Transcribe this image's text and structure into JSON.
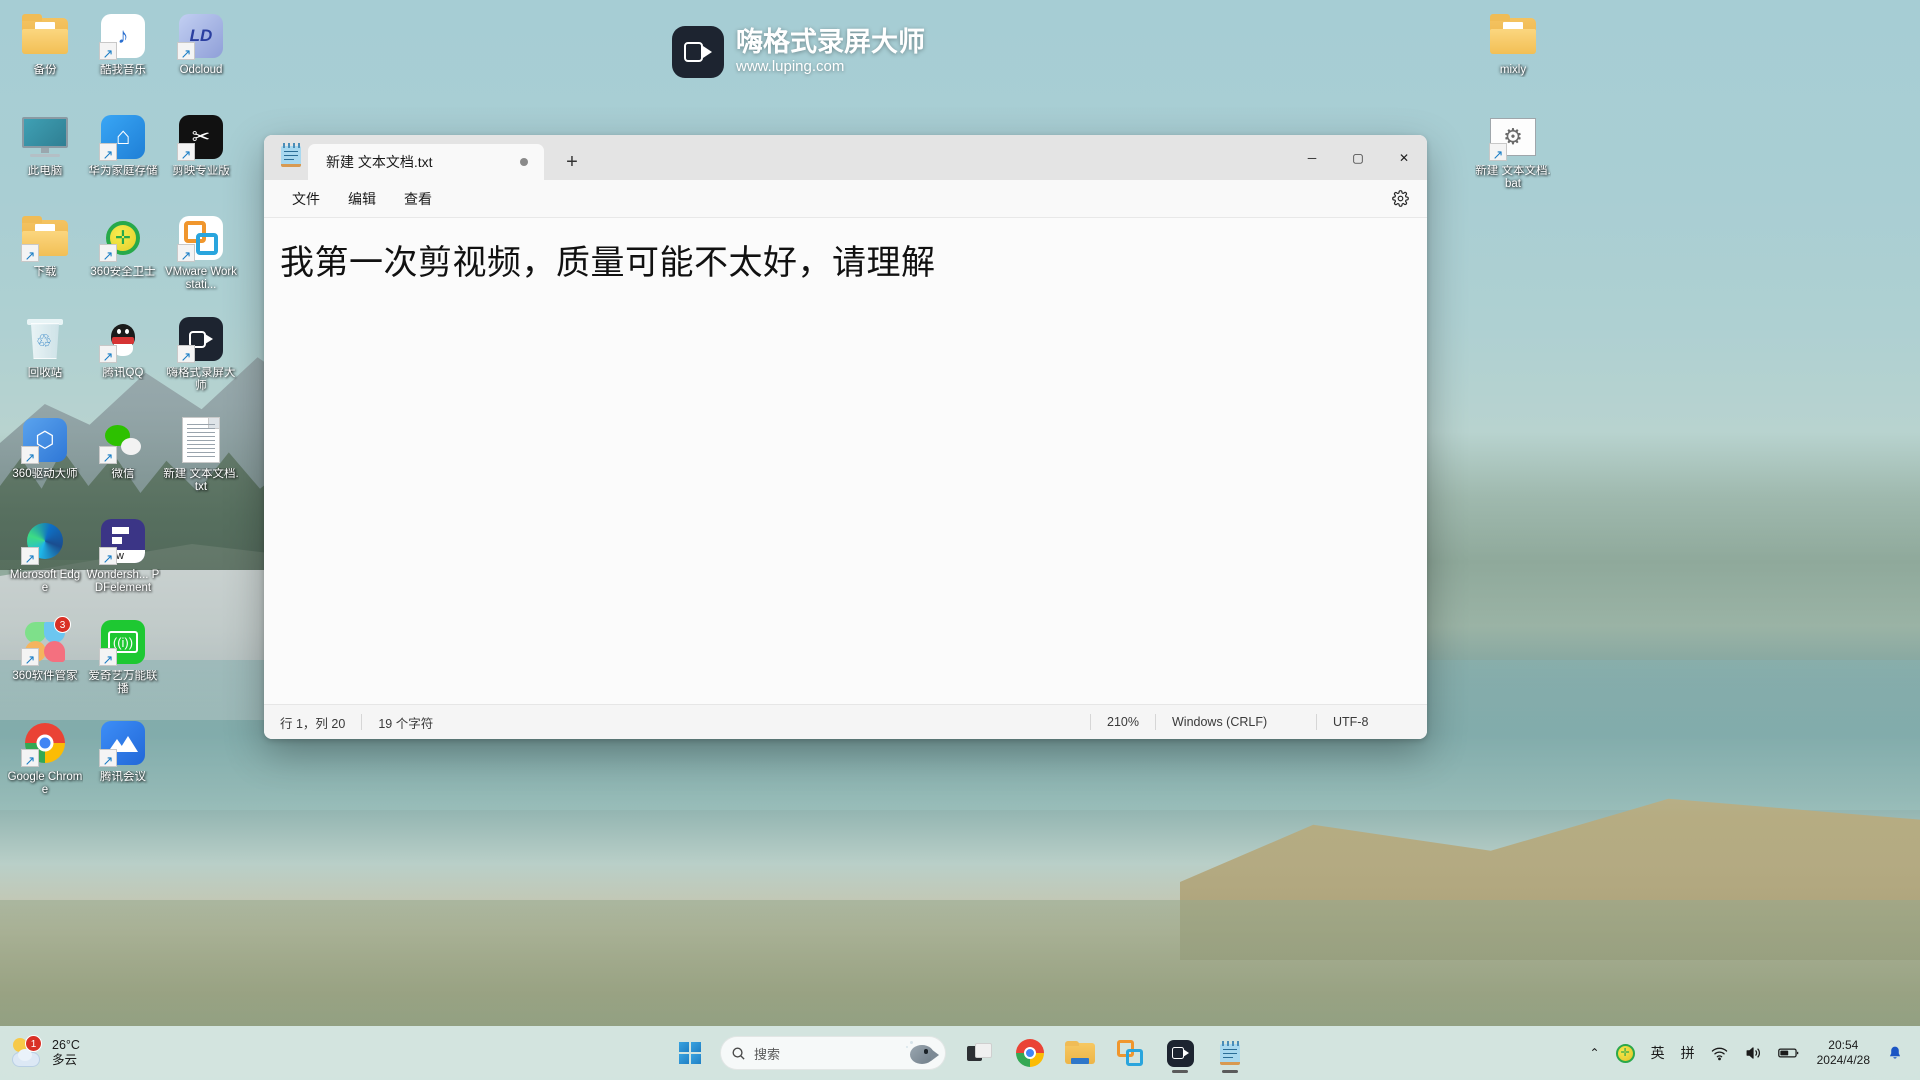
{
  "desktop": {
    "icons_left": [
      {
        "label": "备份",
        "icon": "folder-icon",
        "kind": "folder"
      },
      {
        "label": "酷我音乐",
        "icon": "kuwo-music-icon",
        "kind": "app",
        "color": "#ffffff"
      },
      {
        "label": "Odcloud",
        "icon": "odcloud-icon",
        "kind": "app",
        "color": "#a7b6e8"
      },
      {
        "label": "此电脑",
        "icon": "this-pc-icon",
        "kind": "monitor"
      },
      {
        "label": "华为家庭存储",
        "icon": "huawei-home-storage-icon",
        "kind": "app",
        "color": "#2596f0"
      },
      {
        "label": "剪映专业版",
        "icon": "jianying-pro-icon",
        "kind": "app",
        "color": "#111111"
      },
      {
        "label": "下载",
        "icon": "downloads-folder-icon",
        "kind": "folder"
      },
      {
        "label": "360安全卫士",
        "icon": "360-safe-icon",
        "kind": "app",
        "color": "#f2e33a"
      },
      {
        "label": "VMware Workstati...",
        "icon": "vmware-workstation-icon",
        "kind": "app",
        "color": "#ffffff"
      },
      {
        "label": "回收站",
        "icon": "recycle-bin-icon",
        "kind": "bin"
      },
      {
        "label": "腾讯QQ",
        "icon": "tencent-qq-icon",
        "kind": "app",
        "color": "#ffffff"
      },
      {
        "label": "嗨格式录屏大师",
        "icon": "haigeshi-recorder-icon",
        "kind": "app",
        "color": "#1d2430"
      },
      {
        "label": "360驱动大师",
        "icon": "360-driver-master-icon",
        "kind": "app",
        "color": "#3b8ae8"
      },
      {
        "label": "微信",
        "icon": "wechat-icon",
        "kind": "app",
        "color": "#ffffff"
      },
      {
        "label": "新建 文本文档.txt",
        "icon": "text-document-icon",
        "kind": "txt"
      },
      {
        "label": "Microsoft Edge",
        "icon": "microsoft-edge-icon",
        "kind": "app",
        "color": "#ffffff"
      },
      {
        "label": "Wondersh... PDFelement",
        "icon": "pdfelement-icon",
        "kind": "app",
        "color": "#3b3586"
      },
      {
        "label": "",
        "icon": "empty-slot",
        "kind": "empty"
      },
      {
        "label": "360软件管家",
        "icon": "360-software-manager-icon",
        "kind": "app",
        "color": "#ffffff",
        "badge": "3"
      },
      {
        "label": "爱奇艺万能联播",
        "icon": "iqiyi-player-icon",
        "kind": "app",
        "color": "#1ec832"
      },
      {
        "label": "",
        "icon": "empty-slot",
        "kind": "empty"
      },
      {
        "label": "Google Chrome",
        "icon": "google-chrome-icon",
        "kind": "app",
        "color": "#ffffff"
      },
      {
        "label": "腾讯会议",
        "icon": "tencent-meeting-icon",
        "kind": "app",
        "color": "#2d7ff0"
      }
    ],
    "icons_right": [
      {
        "label": "mixly",
        "icon": "folder-icon",
        "kind": "folder"
      },
      {
        "label": "新建 文本文档.bat",
        "icon": "batch-file-icon",
        "kind": "bat"
      }
    ],
    "watermark": {
      "title": "嗨格式录屏大师",
      "url": "www.luping.com"
    }
  },
  "notepad": {
    "app_icon": "notepad-icon",
    "tab": {
      "title": "新建 文本文档.txt",
      "unsaved_indicator": "●",
      "new_tab_label": "+"
    },
    "window_controls": {
      "minimize": "─",
      "maximize": "▢",
      "close": "✕"
    },
    "menu": [
      {
        "label": "文件",
        "name": "menu-file"
      },
      {
        "label": "编辑",
        "name": "menu-edit"
      },
      {
        "label": "查看",
        "name": "menu-view"
      }
    ],
    "settings_icon": "gear-icon",
    "content": "我第一次剪视频，质量可能不太好，请理解",
    "status_bar": {
      "position": "行 1，列 20",
      "char_count": "19 个字符",
      "zoom": "210%",
      "line_ending": "Windows (CRLF)",
      "encoding": "UTF-8"
    }
  },
  "taskbar": {
    "weather": {
      "temperature": "26°C",
      "condition": "多云",
      "badge": "1",
      "icon": "partly-cloudy-icon"
    },
    "start_label": "开始",
    "search": {
      "placeholder": "搜索",
      "icon": "search-icon",
      "mascot": "fish-icon"
    },
    "apps": [
      {
        "name": "task-view-button",
        "icon": "task-view-icon",
        "active": false
      },
      {
        "name": "taskbar-chrome",
        "icon": "google-chrome-icon",
        "active": false
      },
      {
        "name": "taskbar-file-explorer",
        "icon": "file-explorer-icon",
        "active": false
      },
      {
        "name": "taskbar-vmware",
        "icon": "vmware-icon",
        "active": false
      },
      {
        "name": "taskbar-recorder",
        "icon": "haigeshi-recorder-icon",
        "active": true
      },
      {
        "name": "taskbar-notepad",
        "icon": "notepad-icon",
        "active": true
      }
    ],
    "tray": {
      "overflow": "⌃",
      "security_icon": "360-tray-icon",
      "ime_lang": "英",
      "ime_mode": "拼",
      "wifi_icon": "wifi-icon",
      "volume_icon": "volume-icon",
      "battery_icon": "battery-icon",
      "time": "20:54",
      "date": "2024/4/28",
      "notification_icon": "bell-icon"
    }
  }
}
